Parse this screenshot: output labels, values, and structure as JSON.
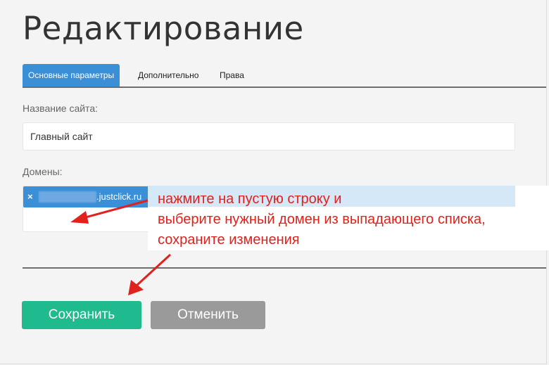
{
  "page": {
    "title": "Редактирование"
  },
  "tabs": [
    {
      "label": "Основные параметры",
      "active": true
    },
    {
      "label": "Дополнительно",
      "active": false
    },
    {
      "label": "Права",
      "active": false
    }
  ],
  "form": {
    "site_name_label": "Название сайта:",
    "site_name_value": "Главный сайт",
    "domains_label": "Домены:",
    "domain_chip": {
      "remove_glyph": "×",
      "domain": ".justclick.ru"
    }
  },
  "annotation": {
    "text": "нажмите на пустую строку и\nвыберите нужный домен из выпадающего списка,\nсохраните изменения",
    "color": "#e0211c"
  },
  "buttons": {
    "save_label": "Сохранить",
    "cancel_label": "Отменить"
  },
  "colors": {
    "accent": "#3a8fd6",
    "save": "#1fba8d",
    "cancel": "#9a9a9a"
  }
}
